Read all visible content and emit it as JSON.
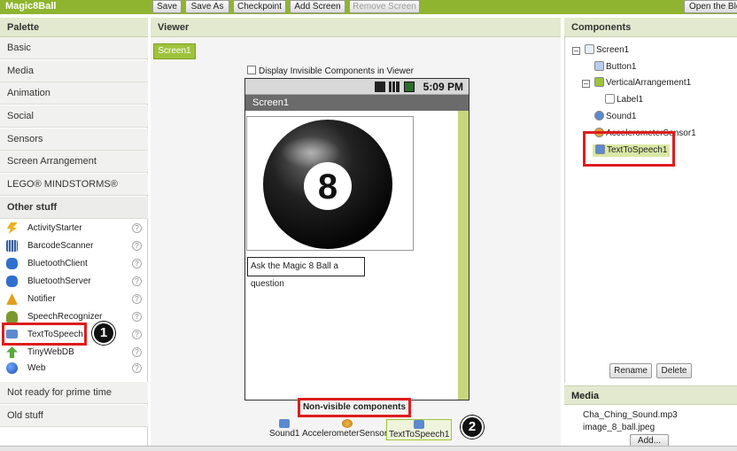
{
  "app": {
    "title": "Magic8Ball"
  },
  "toolbar": {
    "save": "Save",
    "save_as": "Save As",
    "checkpoint": "Checkpoint",
    "add_screen": "Add Screen",
    "remove_screen": "Remove Screen",
    "open_blocks": "Open the Blo"
  },
  "palette": {
    "header": "Palette",
    "categories_top": [
      "Basic",
      "Media",
      "Animation",
      "Social",
      "Sensors",
      "Screen Arrangement",
      "LEGO® MINDSTORMS®",
      "Other stuff"
    ],
    "items": [
      {
        "label": "ActivityStarter",
        "icon": "lightning-icon",
        "color": "#e8b21a"
      },
      {
        "label": "BarcodeScanner",
        "icon": "barcode-icon",
        "color": "#4a7cc4"
      },
      {
        "label": "BluetoothClient",
        "icon": "bluetooth-icon",
        "color": "#2f6fd0"
      },
      {
        "label": "BluetoothServer",
        "icon": "bluetooth-icon",
        "color": "#2f6fd0"
      },
      {
        "label": "Notifier",
        "icon": "warning-icon",
        "color": "#e0a020"
      },
      {
        "label": "SpeechRecognizer",
        "icon": "microphone-icon",
        "color": "#7a9a2e"
      },
      {
        "label": "TextToSpeech",
        "icon": "speech-bubble-icon",
        "color": "#5b8ad0"
      },
      {
        "label": "TinyWebDB",
        "icon": "upload-icon",
        "color": "#5aa83a"
      },
      {
        "label": "Web",
        "icon": "globe-icon",
        "color": "#2466c8"
      }
    ],
    "help_glyph": "?",
    "categories_bottom": [
      "Not ready for prime time",
      "Old stuff"
    ]
  },
  "viewer": {
    "header": "Viewer",
    "screen_tab": "Screen1",
    "invisible_checkbox": "Display Invisible Components in Viewer",
    "status_time": "5:09 PM",
    "screen_title": "Screen1",
    "ball_number": "8",
    "label_text": "Ask the Magic 8 Ball a question",
    "nonvisible_title": "Non-visible components",
    "nonvisible_items": [
      "Sound1",
      "AccelerometerSensor1",
      "TextToSpeech1"
    ]
  },
  "components": {
    "header": "Components",
    "tree": [
      "Screen1",
      "Button1",
      "VerticalArrangement1",
      "Label1",
      "Sound1",
      "AccelerometerSensor1",
      "TextToSpeech1"
    ],
    "rename": "Rename",
    "delete": "Delete"
  },
  "media": {
    "header": "Media",
    "files": [
      "Cha_Ching_Sound.mp3",
      "image_8_ball.jpeg"
    ],
    "add": "Add..."
  },
  "annotations": {
    "one": "1",
    "two": "2"
  },
  "colors": {
    "accent": "#8fb42f",
    "highlight": "#dd1d1d"
  }
}
